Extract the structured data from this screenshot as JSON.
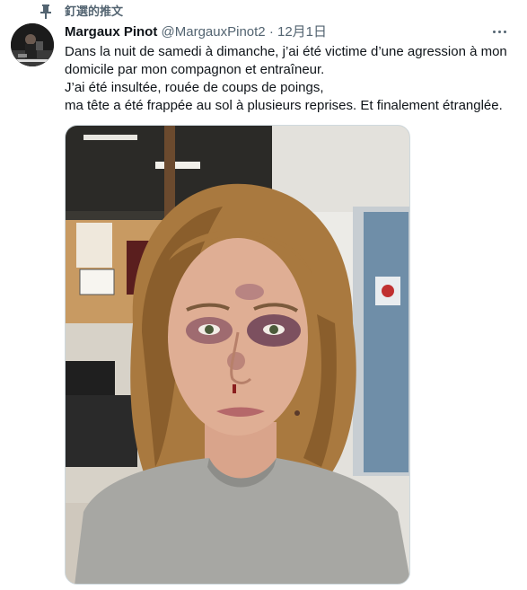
{
  "pinned": {
    "label": "釘選的推文",
    "icon": "pin-icon"
  },
  "author": {
    "name": "Margaux Pinot",
    "handle": "@MargauxPinot2",
    "separator": "·",
    "date": "12月1日",
    "avatar_icon": "avatar"
  },
  "tweet": {
    "lines": [
      "Dans la nuit de samedi à dimanche, j’ai été victime d’une agression à mon domicile par mon compagnon et entraîneur.",
      "J’ai été insultée, rouée de coups de poings,",
      "ma tête a été frappée au sol à plusieurs reprises. Et finalement étranglée."
    ]
  },
  "colors": {
    "text": "#0f1419",
    "secondary": "#536471",
    "border": "#cfd9de"
  }
}
